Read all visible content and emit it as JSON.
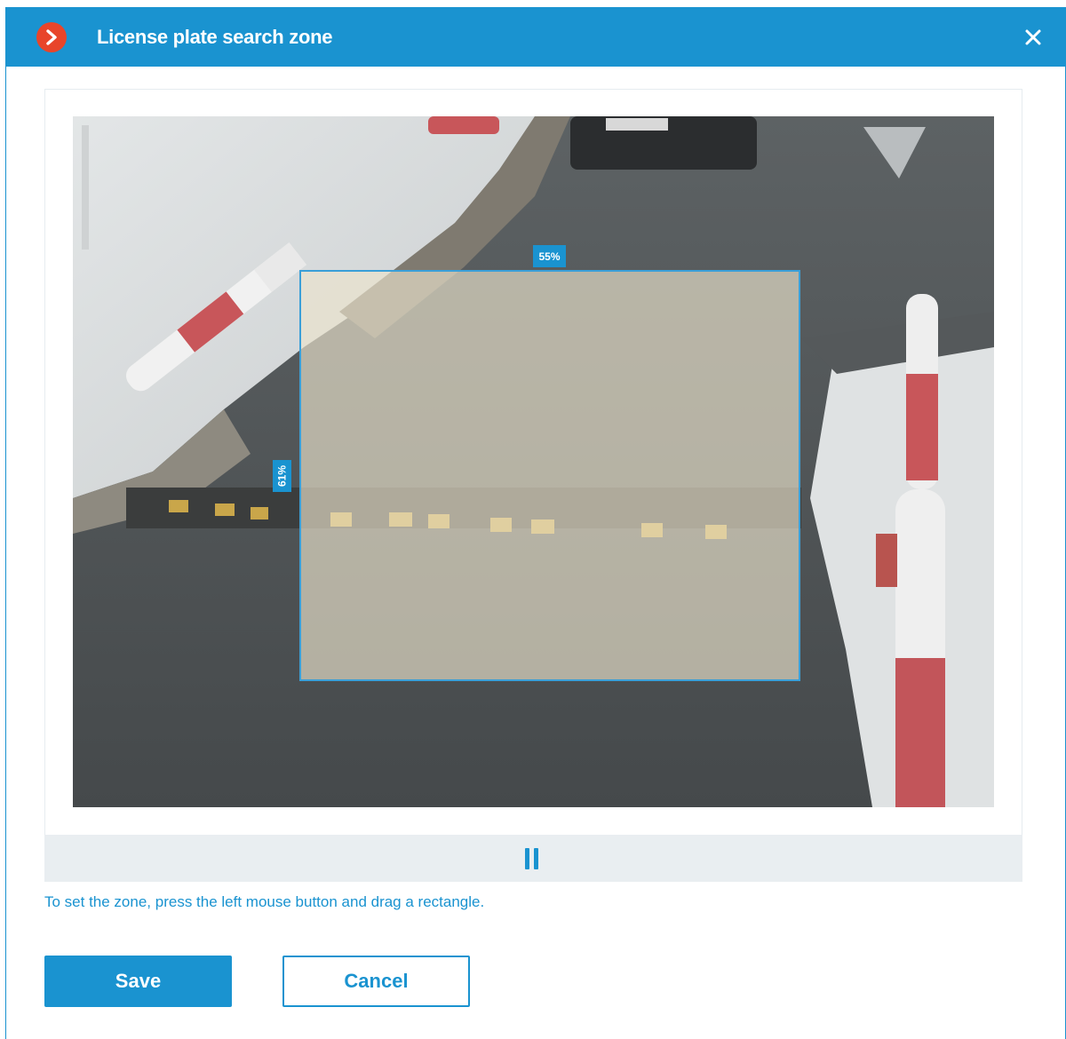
{
  "dialog": {
    "title": "License plate search zone",
    "close_icon": "close-icon",
    "logo_icon": "app-logo-icon"
  },
  "zone": {
    "width_label": "55%",
    "height_label": "61%"
  },
  "controls": {
    "pause_icon": "pause-icon"
  },
  "hint": "To set the zone,  press the left mouse button and drag a rectangle.",
  "buttons": {
    "save_label": "Save",
    "cancel_label": "Cancel"
  },
  "colors": {
    "accent": "#1a93d0",
    "logo": "#e8452a"
  }
}
